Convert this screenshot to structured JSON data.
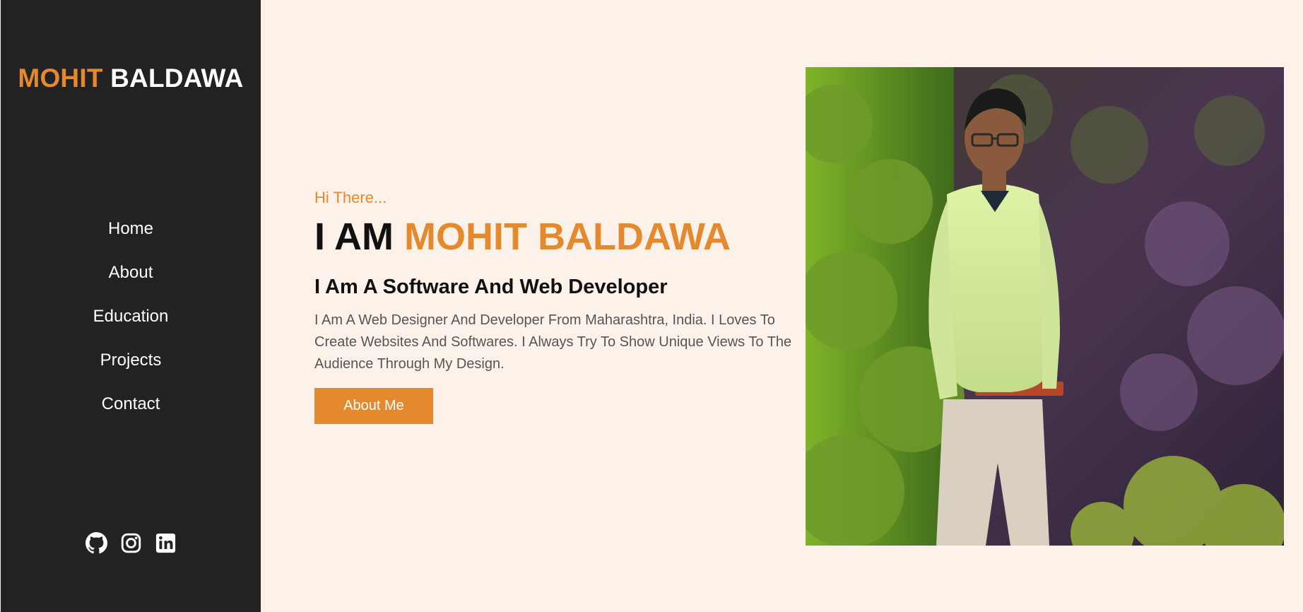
{
  "sidebar": {
    "brand": {
      "first": "MOHIT",
      "last": "BALDAWA"
    },
    "nav": [
      {
        "label": "Home"
      },
      {
        "label": "About"
      },
      {
        "label": "Education"
      },
      {
        "label": "Projects"
      },
      {
        "label": "Contact"
      }
    ],
    "socials": [
      "github-icon",
      "instagram-icon",
      "linkedin-icon"
    ]
  },
  "hero": {
    "greeting": "Hi There...",
    "headline_prefix": "I AM",
    "headline_name": "MOHIT BALDAWA",
    "subtitle": "I Am A Software And Web Developer",
    "description": "I Am A Web Designer And Developer From Maharashtra, India. I Loves To Create Websites And Softwares. I Always Try To Show Unique Views To The Audience Through My Design.",
    "button_label": "About Me"
  },
  "photo": {
    "subject": "portrait photo"
  },
  "colors": {
    "accent": "#e4892d",
    "sidebar_bg": "#222222",
    "page_bg": "#fdf2e9"
  }
}
